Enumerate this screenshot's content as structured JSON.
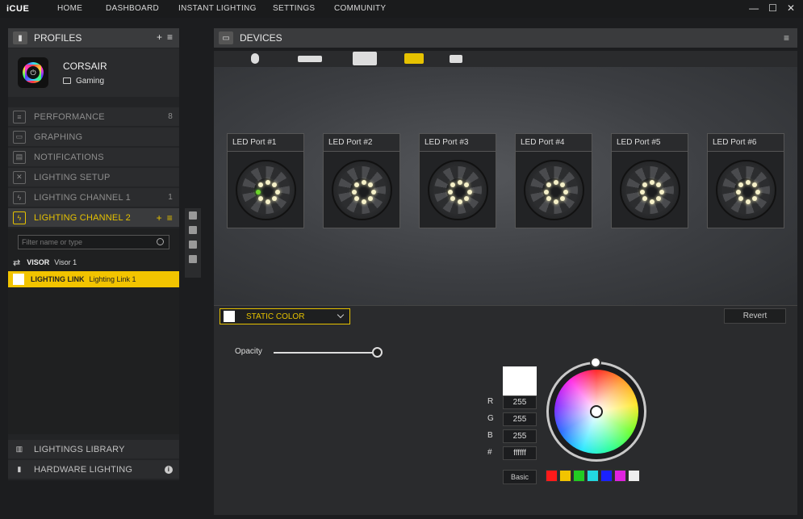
{
  "app": {
    "logo": "iCUE"
  },
  "nav": [
    "HOME",
    "DASHBOARD",
    "INSTANT LIGHTING",
    "SETTINGS",
    "COMMUNITY"
  ],
  "window": {
    "minimize": "—",
    "maximize": "☐",
    "close": "✕"
  },
  "profiles": {
    "header": "PROFILES",
    "add": "+",
    "menu": "≡",
    "profile_name": "CORSAIR",
    "profile_sub": "Gaming"
  },
  "menu": [
    {
      "label": "PERFORMANCE",
      "count": "8",
      "icon": "performance-icon"
    },
    {
      "label": "GRAPHING",
      "count": "",
      "icon": "graph-icon"
    },
    {
      "label": "NOTIFICATIONS",
      "count": "",
      "icon": "notification-icon"
    },
    {
      "label": "LIGHTING SETUP",
      "count": "",
      "icon": "tools-icon"
    },
    {
      "label": "LIGHTING CHANNEL 1",
      "count": "1",
      "icon": "lightning-icon"
    }
  ],
  "active_channel": {
    "label": "LIGHTING CHANNEL 2",
    "add": "+",
    "menu": "≡"
  },
  "filter": {
    "placeholder": "Filter name or type"
  },
  "effects": [
    {
      "type": "VISOR",
      "name": "Visor 1"
    },
    {
      "type": "LIGHTING LINK",
      "name": "Lighting Link 1"
    }
  ],
  "bottom_menu": [
    {
      "label": "LIGHTINGS LIBRARY"
    },
    {
      "label": "HARDWARE LIGHTING"
    }
  ],
  "devices": {
    "header": "DEVICES"
  },
  "ports": [
    "LED Port #1",
    "LED Port #2",
    "LED Port #3",
    "LED Port #4",
    "LED Port #5",
    "LED Port #6"
  ],
  "effect_bar": {
    "selected": "STATIC COLOR",
    "revert": "Revert"
  },
  "color": {
    "opacity_label": "Opacity",
    "opacity_value": 1.0,
    "r_label": "R",
    "r": "255",
    "g_label": "G",
    "g": "255",
    "b_label": "B",
    "b": "255",
    "hex_label": "#",
    "hex": "ffffff",
    "basic": "Basic",
    "presets": [
      "#ff1a1a",
      "#f2c400",
      "#22cc22",
      "#22d8e0",
      "#1a22ff",
      "#e022e0",
      "#eeeeee"
    ]
  },
  "colors": {
    "accent": "#e6c200"
  }
}
